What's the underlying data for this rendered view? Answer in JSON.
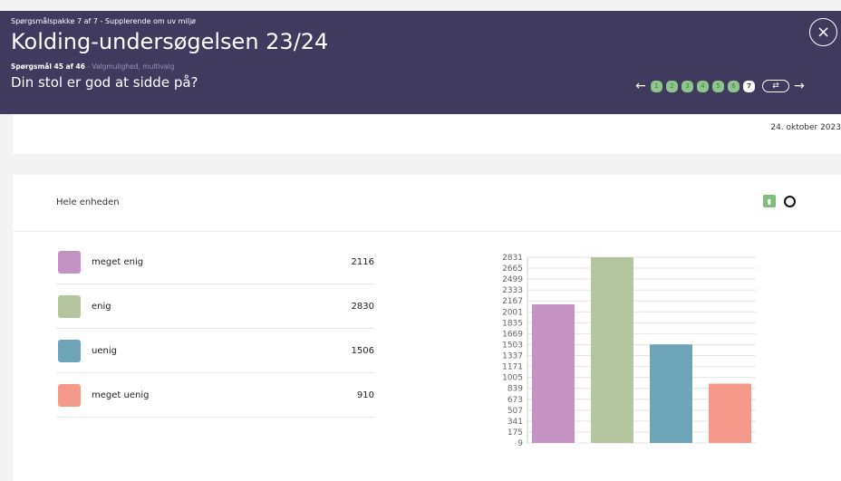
{
  "header": {
    "package": "Spørgsmålspakke 7 af 7 - Supplerende om uv miljø",
    "title": "Kolding-undersøgelsen 23/24",
    "question_number": "Spørgsmål 45 af 46",
    "question_type": " - Valgmulighed, multivalg",
    "question": "Din stol er god at sidde på?",
    "close_icon": "×",
    "prev_arrow": "←",
    "next_arrow": "→",
    "steps": [
      "1",
      "2",
      "3",
      "4",
      "5",
      "6",
      "7"
    ],
    "current_step": "7",
    "switch_icon": "⇄"
  },
  "date": "24. oktober 2023",
  "unit_label": "Hele enheden",
  "legend": [
    {
      "label": "meget enig",
      "value": "2116",
      "color": "#c493c4"
    },
    {
      "label": "enig",
      "value": "2830",
      "color": "#b5c59f"
    },
    {
      "label": "uenig",
      "value": "1506",
      "color": "#6ea4b8"
    },
    {
      "label": "meget uenig",
      "value": "910",
      "color": "#f59a8a"
    }
  ],
  "chart_data": {
    "type": "bar",
    "categories": [
      "meget enig",
      "enig",
      "uenig",
      "meget uenig"
    ],
    "values": [
      2116,
      2830,
      1506,
      910
    ],
    "colors": [
      "#c493c4",
      "#b5c59f",
      "#6ea4b8",
      "#f59a8a"
    ],
    "yticks": [
      "2831",
      "2665",
      "2499",
      "2333",
      "2167",
      "2001",
      "1835",
      "1669",
      "1503",
      "1337",
      "1171",
      "1005",
      "839",
      "673",
      "507",
      "341",
      "175",
      "9"
    ],
    "ylim": [
      9,
      2831
    ],
    "grid": true
  }
}
